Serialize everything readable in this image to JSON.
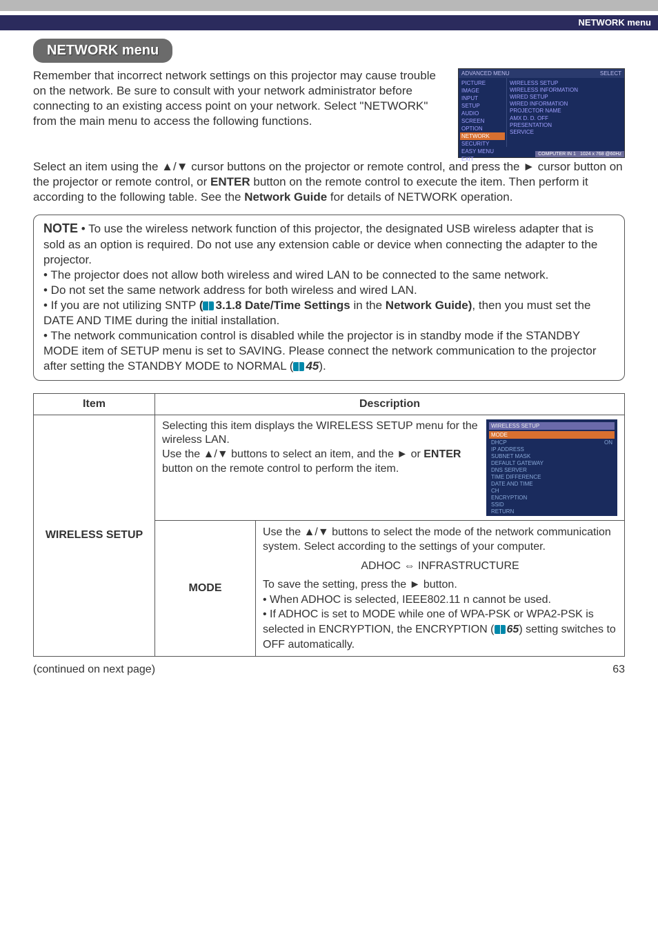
{
  "category_header": "NETWORK menu",
  "section_title": "NETWORK menu",
  "intro": {
    "p1": "Remember that incorrect network settings on this projector may cause trouble on the network. Be sure to consult with your network administrator before connecting to an existing access point on your network. Select \"NETWORK\" from the main menu to access the following functions.",
    "p2a": "Select an item using the ▲/▼ cursor buttons on the projector or remote control, and press the ► cursor button on the projector or remote control, or ",
    "p2b": "ENTER",
    "p2c": " button on the remote control to execute the item. Then perform it according to the following table. See the ",
    "p2d": "Network Guide",
    "p2e": " for details of NETWORK operation."
  },
  "menu_screenshot": {
    "header_left": "ADVANCED MENU",
    "header_right": "SELECT",
    "left_items": [
      "PICTURE",
      "IMAGE",
      "INPUT",
      "SETUP",
      "AUDIO",
      "SCREEN",
      "OPTION",
      "NETWORK",
      "SECURITY",
      "EASY MENU",
      "EXIT"
    ],
    "right_items": [
      "WIRELESS SETUP",
      "WIRELESS INFORMATION",
      "WIRED SETUP",
      "WIRED INFORMATION",
      "PROJECTOR NAME",
      "",
      "AMX D. D.           OFF",
      "PRESENTATION",
      "SERVICE"
    ],
    "footer_left": "COMPUTER IN 1",
    "footer_right": "1024 x 768 @60Hz"
  },
  "note": {
    "label": "NOTE",
    "bullet1": " • To use the wireless network function of this projector, the designated USB wireless adapter that is sold as an option is required. Do not use any extension cable or device when connecting the adapter to the projector.",
    "bullet2": "• The projector does not allow both wireless and wired LAN to be connected to the same network.",
    "bullet3": "• Do not set the same network address for both wireless and wired LAN.",
    "bullet4a": "• If you are not utilizing SNTP ",
    "bullet4b": "(",
    "bullet4c": "3.1.8 Date/Time Settings",
    "bullet4d": " in the ",
    "bullet4e": "Network Guide)",
    "bullet4f": ", then you must set the DATE AND TIME during the initial installation.",
    "bullet5a": "• The network communication control is disabled while the projector is in standby mode if the STANDBY MODE item of SETUP menu is set to SAVING. Please connect the network communication to the projector after setting the STANDBY MODE to NORMAL (",
    "bullet5b": "45",
    "bullet5c": ")."
  },
  "table": {
    "head_item": "Item",
    "head_desc": "Description",
    "row1_item": "WIRELESS SETUP",
    "row1_desc_top": "Selecting this item displays the WIRELESS SETUP menu for the wireless LAN.\nUse the ▲/▼ buttons to select an item, and the ► or ENTER button on the remote control to perform the item.",
    "wireless_shot": {
      "header_l": "WIRELESS SETUP",
      "mode_row_l": "MODE",
      "rows": [
        [
          "DHCP",
          "ON"
        ],
        [
          "IP ADDRESS",
          ""
        ],
        [
          "SUBNET MASK",
          ""
        ],
        [
          "DEFAULT GATEWAY",
          ""
        ],
        [
          "DNS SERVER",
          ""
        ],
        [
          "TIME DIFFERENCE",
          ""
        ],
        [
          "DATE AND TIME",
          ""
        ],
        [
          "CH",
          ""
        ],
        [
          "ENCRYPTION",
          ""
        ],
        [
          "SSID",
          ""
        ],
        [
          "RETURN",
          ""
        ]
      ]
    },
    "row2_sub": "MODE",
    "row2_desc": {
      "p1": "Use the ▲/▼ buttons to select the mode of the network communication system. Select according to the settings of your computer.",
      "adhoc": "ADHOC ⇔ INFRASTRUCTURE",
      "p2": "To save the setting, press the ► button.",
      "p3a": "• When ADHOC is selected, IEEE802.11 n cannot be used.",
      "p3b": "• If ADHOC is set to MODE while one of WPA-PSK or WPA2-PSK is selected in ENCRYPTION, the ENCRYPTION (",
      "p3c": "65",
      "p3d": ") setting switches to OFF automatically."
    }
  },
  "footer": {
    "continued": "(continued on next page)",
    "page": "63"
  }
}
